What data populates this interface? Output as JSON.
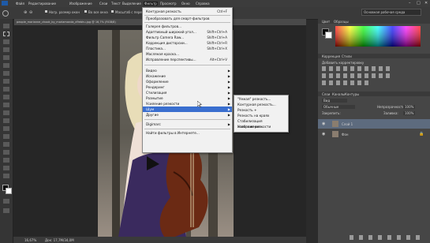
{
  "menubar": [
    "Файл",
    "Редактирование",
    "Изображение",
    "Слои",
    "Текст",
    "Выделение",
    "Фильтр",
    "Просмотр",
    "Окно",
    "Справка"
  ],
  "workspace": "Основная рабочая среда",
  "optionsbar": {
    "sample_all_layers": "Нагр. размер окон",
    "fit_screen": "Во все окна",
    "scrubby_zoom": "Масштаб с перетаскиванием"
  },
  "document_tab": "people_marianne_chook_by_mariamanda_d9ebhu.jpg @ 16,7% (RGB/8)",
  "status": {
    "zoom": "16,67%",
    "doc": "Док: 17,7M/34,0M"
  },
  "filter_menu": {
    "last_filter": "Контурная резкость",
    "last_filter_sc": "Ctrl+F",
    "smart_filters": "Преобразовать для смарт-фильтров",
    "items": [
      {
        "label": "Галерея фильтров...",
        "sc": ""
      },
      {
        "label": "Адаптивный широкий угол...",
        "sc": "Shift+Ctrl+A"
      },
      {
        "label": "Фильтр Camera Raw...",
        "sc": "Shift+Ctrl+A"
      },
      {
        "label": "Коррекция дисторсии...",
        "sc": "Shift+Ctrl+R"
      },
      {
        "label": "Пластика...",
        "sc": "Shift+Ctrl+X"
      },
      {
        "label": "Масляная краска...",
        "sc": ""
      },
      {
        "label": "Исправление перспективы...",
        "sc": "Alt+Ctrl+V"
      }
    ],
    "sub": [
      "Видео",
      "Искажение",
      "Оформление",
      "Рендеринг",
      "Стилизация",
      "Размытие",
      "Усиление резкости",
      "Шум",
      "Другие"
    ],
    "highlighted": "Шум",
    "digimarc": "Digimarc",
    "browse": "Найти фильтры в Интернете..."
  },
  "noise_submenu": [
    "\"Умная\" резкость...",
    "Контурная резкость...",
    "Резкость +",
    "Резкость на краях",
    "Стабилизация изображения...",
    "Усиление резкости"
  ],
  "panels": {
    "color_tab": "Цвет",
    "swatches_tab": "Образцы",
    "adjust_tab": "Коррекция",
    "styles_tab": "Стили",
    "adjust_hint": "Добавить корректировку",
    "layers_tab": "Слои",
    "channels_tab": "Каналы",
    "paths_tab": "Контуры",
    "kind": "Вид",
    "blend": "Обычные",
    "opacity_label": "Непрозрачность:",
    "opacity": "100%",
    "lock": "Закрепить:",
    "fill_label": "Заливка:",
    "fill": "100%"
  },
  "layers": [
    {
      "name": "Слой 1",
      "selected": true
    },
    {
      "name": "Фон",
      "selected": false
    }
  ],
  "colors": {
    "menu_bg": "#f1f1f1",
    "highlight": "#3a6fcf",
    "app_bg": "#2b2b2b",
    "panel_bg": "#464646"
  }
}
